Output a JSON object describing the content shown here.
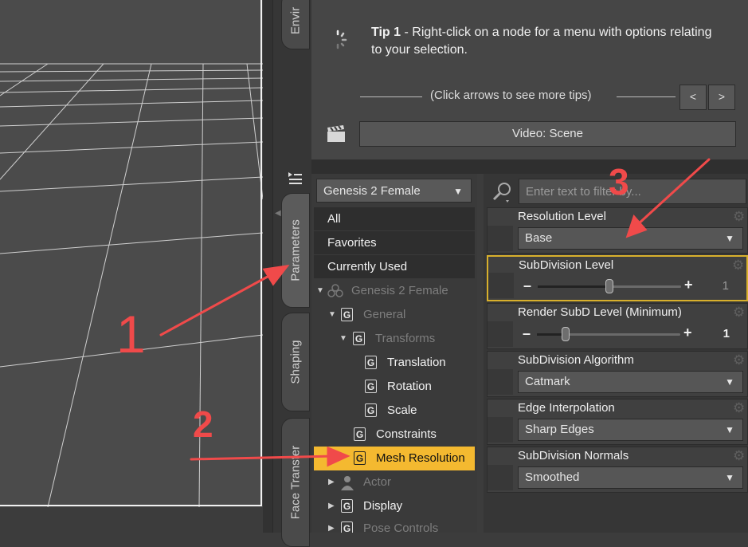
{
  "colors": {
    "accent": "#f4b930",
    "annotation": "#f04a4a",
    "focus": "#d8b02c"
  },
  "side_tabs": [
    "Envir",
    "Parameters",
    "Shaping",
    "Face Transfer"
  ],
  "tips": {
    "number": "Tip 1",
    "text": " - Right-click on a node for a menu with options relating to your selection.",
    "hint": "(Click arrows to see more tips)",
    "prev": "<",
    "next": ">",
    "video_label": "Video: Scene"
  },
  "figure_select": {
    "value": "Genesis 2 Female"
  },
  "list": {
    "all": "All",
    "favorites": "Favorites",
    "currently_used": "Currently Used",
    "tree": {
      "root": "Genesis 2 Female",
      "general": "General",
      "transforms": "Transforms",
      "translation": "Translation",
      "rotation": "Rotation",
      "scale": "Scale",
      "constraints": "Constraints",
      "mesh_resolution": "Mesh Resolution",
      "actor": "Actor",
      "display": "Display",
      "pose_controls": "Pose Controls"
    },
    "g_glyph": "G"
  },
  "search": {
    "placeholder": "Enter text to filter by..."
  },
  "params": {
    "resolution_level": {
      "label": "Resolution Level",
      "value": "Base"
    },
    "subdivision_level": {
      "label": "SubDivision Level",
      "value": "1",
      "level": 0.5
    },
    "render_subd": {
      "label": "Render SubD Level (Minimum)",
      "value": "1",
      "level": 0.2
    },
    "subdivision_algorithm": {
      "label": "SubDivision Algorithm",
      "value": "Catmark"
    },
    "edge_interpolation": {
      "label": "Edge Interpolation",
      "value": "Sharp Edges"
    },
    "subdivision_normals": {
      "label": "SubDivision Normals",
      "value": "Smoothed"
    }
  },
  "annotations": {
    "one": "1",
    "two": "2",
    "three": "3"
  }
}
